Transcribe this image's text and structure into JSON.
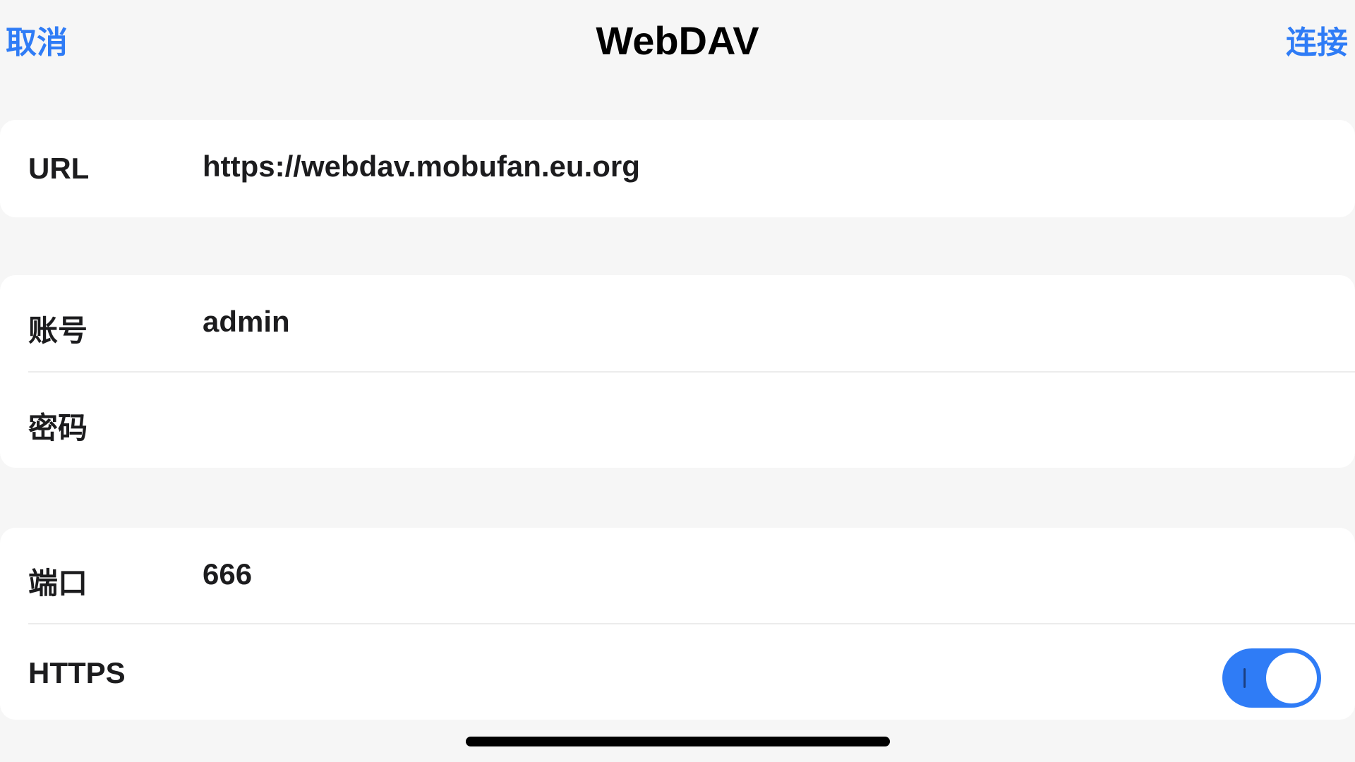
{
  "nav": {
    "cancel_label": "取消",
    "title": "WebDAV",
    "connect_label": "连接"
  },
  "url_section": {
    "label": "URL",
    "value": "https://webdav.mobufan.eu.org"
  },
  "account_section": {
    "account_label": "账号",
    "account_value": "admin",
    "password_label": "密码",
    "password_value": ""
  },
  "port_section": {
    "port_label": "端口",
    "port_value": "666",
    "https_label": "HTTPS",
    "https_enabled": true
  },
  "colors": {
    "accent": "#2f7cf6",
    "background": "#f6f6f6",
    "card": "#ffffff"
  }
}
